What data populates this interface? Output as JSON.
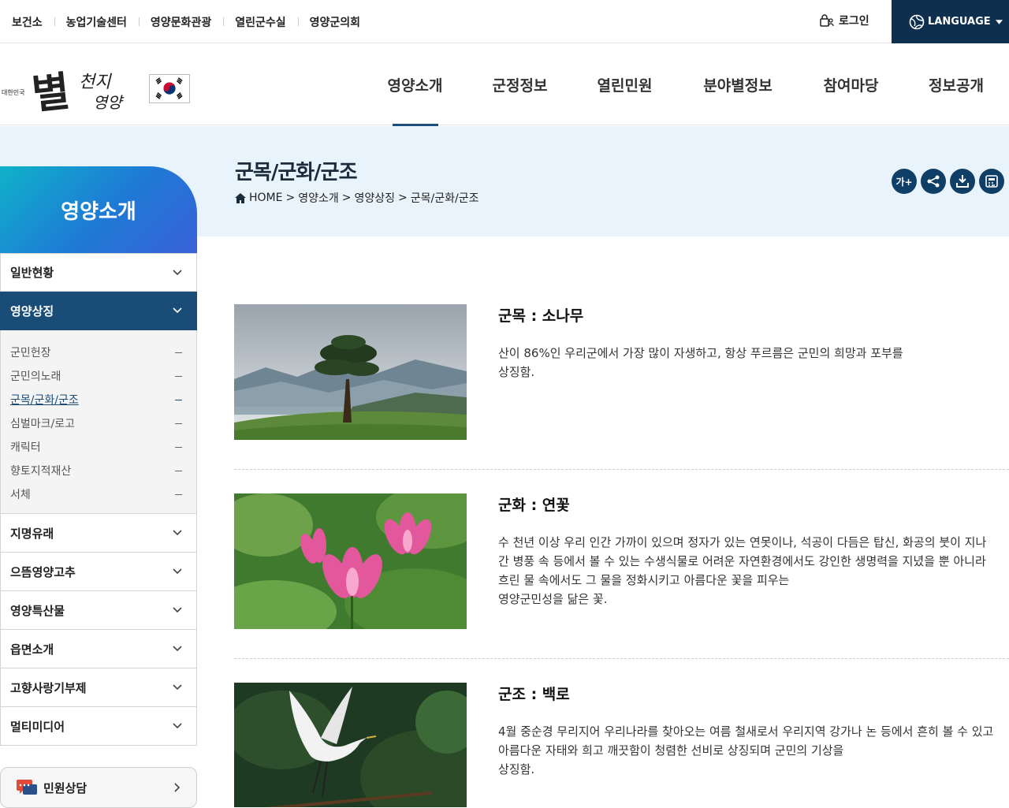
{
  "top_links": [
    "보건소",
    "농업기술센터",
    "영양문화관광",
    "열린군수실",
    "영양군의회"
  ],
  "login_label": "로그인",
  "language_label": "LANGUAGE",
  "logo": {
    "small": "대한민국",
    "main": "별",
    "sub1": "천지",
    "sub2": "영양"
  },
  "gnb": [
    "영양소개",
    "군정정보",
    "열린민원",
    "분야별정보",
    "참여마당",
    "정보공개"
  ],
  "page_title": "군목/군화/군조",
  "breadcrumb": {
    "home": "HOME",
    "level1": "영양소개",
    "level2": "영양상징",
    "current": "군목/군화/군조"
  },
  "tools": {
    "font": "가+"
  },
  "sidebar": {
    "title": "영양소개",
    "items": [
      {
        "label": "일반현황"
      },
      {
        "label": "영양상징",
        "active": true,
        "sub": [
          "군민헌장",
          "군민의노래",
          "군목/군화/군조",
          "심벌마크/로고",
          "캐릭터",
          "향토지적재산",
          "서체"
        ]
      },
      {
        "label": "지명유래"
      },
      {
        "label": "으뜸영양고추"
      },
      {
        "label": "영양특산물"
      },
      {
        "label": "읍면소개"
      },
      {
        "label": "고향사랑기부제"
      },
      {
        "label": "멀티미디어"
      }
    ],
    "consult_label": "민원상담"
  },
  "symbols": [
    {
      "title": "군목 : 소나무",
      "lines": [
        "산이 86%인 우리군에서 가장 많이 자생하고, 항상 푸르름은 군민의 희망과 포부를",
        "상징함."
      ]
    },
    {
      "title": "군화 : 연꽃",
      "lines": [
        "수 천년 이상 우리 인간 가까이 있으며 정자가 있는 연못이나, 석공이 다듬은 탑신, 화공의 붓이 지나",
        "간 병풍 속 등에서 볼 수 있는 수생식물로 어려운 자연환경에서도 강인한 생명력을 지녔을 뿐 아니라",
        "흐린 물 속에서도 그 물을 정화시키고 아름다운 꽃을 피우는",
        "영양군민성을 닮은 꽃."
      ]
    },
    {
      "title": "군조 : 백로",
      "lines": [
        "4월 중순경 무리지어 우리나라를 찾아오는 여름 철새로서 우리지역 강가나 논 등에서 흔히 볼 수 있고",
        "아름다운 자태와 희고 깨끗함이 청렴한 선비로 상징되며 군민의 기상을",
        "상징함."
      ]
    }
  ]
}
